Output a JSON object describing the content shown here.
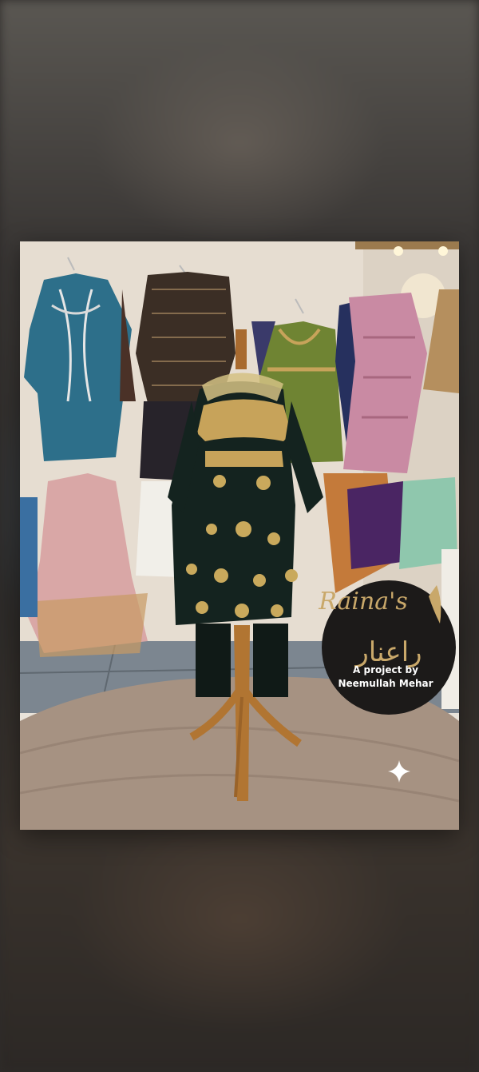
{
  "logo": {
    "brand_en": "Raina's",
    "brand_ur": "راعنار",
    "tagline_line1": "A project by",
    "tagline_line2": "Neemullah Mehar"
  },
  "icons": [
    "sparkle-icon"
  ],
  "colors": {
    "backdrop": "#2f2c2a",
    "badge_bg": "#1c1a19",
    "gold_text": "#c9a86a",
    "dress_dark": "#12201d",
    "embroidery": "#c9a95c",
    "rug": "#a48f80"
  }
}
